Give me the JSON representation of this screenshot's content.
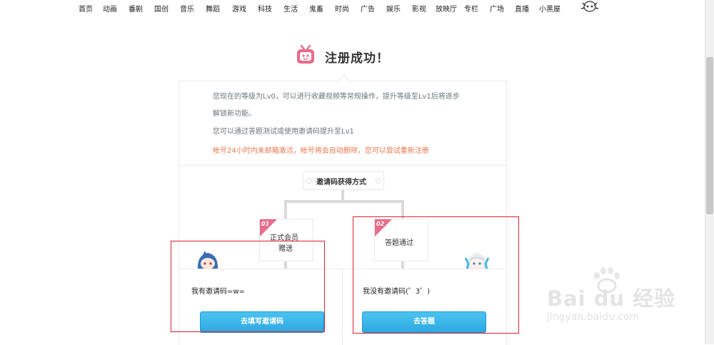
{
  "nav": {
    "items": [
      "首页",
      "动画",
      "番剧",
      "国创",
      "音乐",
      "舞蹈",
      "游戏",
      "科技",
      "生活",
      "鬼畜",
      "时尚",
      "广告",
      "娱乐",
      "影视",
      "放映厅",
      "专栏",
      "广场",
      "直播",
      "小黑屋"
    ]
  },
  "header": {
    "title": "注册成功！"
  },
  "info": {
    "line1": "您现在的等级为Lv0，可以进行收藏视频等常规操作，提升等级至Lv1后将逐步",
    "line2": "解锁新功能。",
    "line3": "您可以通过答题测试或使用邀请码提升至Lv1",
    "warn": "帐号24小时内未邮箱激活，帐号将会自动删除，您可以尝试重新注册"
  },
  "methods": {
    "label": "邀请码获得方式",
    "option1": {
      "num": "01",
      "label_line1": "正式会员",
      "label_line2": "赠送"
    },
    "option2": {
      "num": "02",
      "label": "答题通过"
    }
  },
  "cards": {
    "left": {
      "text": "我有邀请码=w=",
      "button": "去填写邀请码"
    },
    "right": {
      "text": "我没有邀请码(゜3゜)",
      "button": "去答题"
    }
  },
  "watermark": {
    "brand": "Bai du 经验",
    "url": "jingyan.baidu.com"
  },
  "colors": {
    "accent_pink": "#e86d8a",
    "button_blue": "#2ea8e3",
    "warn_orange": "#e8774e",
    "highlight_red": "#d9232e"
  }
}
